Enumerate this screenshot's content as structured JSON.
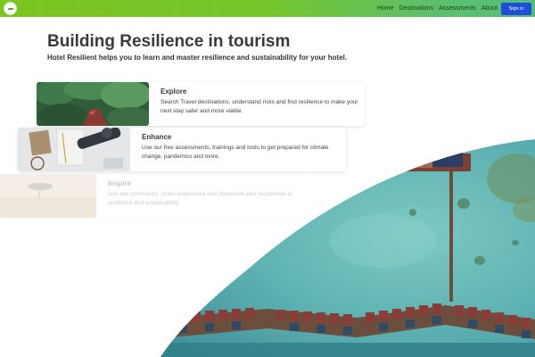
{
  "nav": {
    "logo_icon": "hotel-resilient-logo-icon",
    "links": [
      "Home",
      "Destinations",
      "Assessments",
      "About"
    ],
    "signin_label": "Sign in",
    "colors": {
      "bar_start": "#7cc41f",
      "bar_end": "#55bd7a",
      "button": "#1d4ed8"
    }
  },
  "hero": {
    "title": "Building Resilience in tourism",
    "subtitle": "Hotel Resilient helps you to learn and master resilience and sustainability for your hotel."
  },
  "cards": [
    {
      "title": "Explore",
      "description": "Search Travel destinations, understand risks and find resilience to make your next stay safer and more viable.",
      "image": "forest-road-photo"
    },
    {
      "title": "Enhance",
      "description": "Use our free assessments, trainings and tools to get prepared for climate change, pandemics and more.",
      "image": "desk-notebook-photo"
    },
    {
      "title": "Inspire",
      "description": "Join our community, share experience and showcase your excellence in resilience and sustainability.",
      "image": "savanna-tree-photo"
    }
  ],
  "background_image": "aerial-overwater-villas-photo"
}
